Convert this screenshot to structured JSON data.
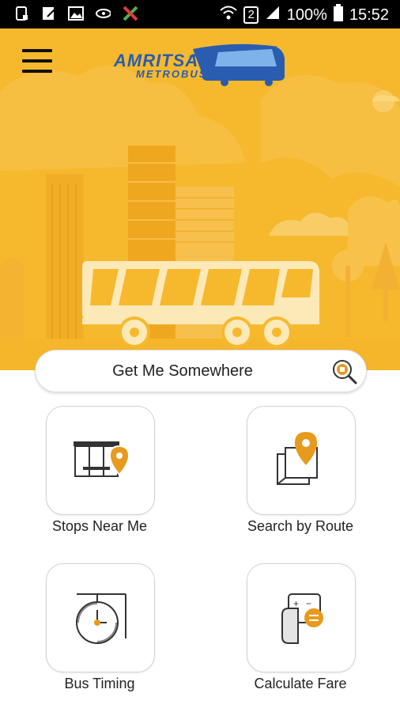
{
  "status_bar": {
    "battery": "100%",
    "time": "15:52",
    "sim_slot": "2",
    "icons": [
      "notification-icon",
      "edit-icon",
      "gallery-icon",
      "link-icon",
      "tools-icon",
      "wifi-icon",
      "signal-icon",
      "battery-icon"
    ]
  },
  "header": {
    "brand_line1": "AMRITSAR",
    "brand_line2": "METROBUS"
  },
  "search": {
    "label": "Get Me Somewhere"
  },
  "tiles": [
    {
      "label": "Stops Near Me",
      "icon": "bus-stop-icon"
    },
    {
      "label": "Search by Route",
      "icon": "route-map-icon"
    },
    {
      "label": "Bus Timing",
      "icon": "clock-icon"
    },
    {
      "label": "Calculate Fare",
      "icon": "fare-calculator-icon"
    }
  ],
  "colors": {
    "hero": "#f6b92e",
    "accent": "#e89a1c",
    "brand_blue": "#2a5db0"
  }
}
